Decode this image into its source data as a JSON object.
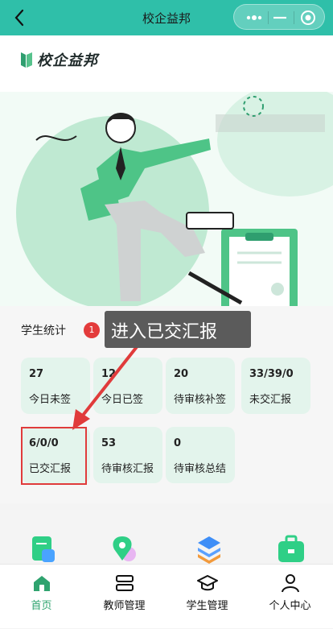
{
  "titlebar": {
    "title": "校企益邦"
  },
  "header": {
    "logo_text": "校企益邦"
  },
  "stats": {
    "title": "学生统计",
    "items": [
      {
        "value": "27",
        "label": "今日未签"
      },
      {
        "value": "12",
        "label": "今日已签"
      },
      {
        "value": "20",
        "label": "待审核补签"
      },
      {
        "value": "33/39/0",
        "label": "未交汇报"
      },
      {
        "value": "6/0/0",
        "label": "已交汇报"
      },
      {
        "value": "53",
        "label": "待审核汇报"
      },
      {
        "value": "0",
        "label": "待审核总结"
      }
    ]
  },
  "annotation": {
    "badge": "1",
    "text": "进入已交汇报"
  },
  "tabbar": {
    "items": [
      {
        "label": "首页",
        "icon": "home-icon",
        "active": true
      },
      {
        "label": "教师管理",
        "icon": "teacher-icon"
      },
      {
        "label": "学生管理",
        "icon": "graduation-cap-icon"
      },
      {
        "label": "个人中心",
        "icon": "person-icon"
      }
    ]
  },
  "colors": {
    "accent": "#2fbfa9",
    "card": "#e3f4ec",
    "highlight": "#e03b3b",
    "active_tab": "#2fa36f"
  }
}
